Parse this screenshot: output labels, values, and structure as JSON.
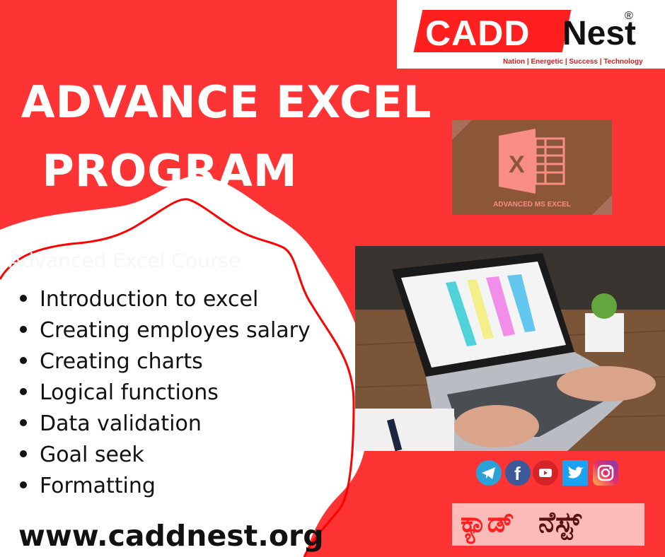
{
  "brand": {
    "name_part1": "CADD",
    "name_part2": "Nest",
    "registered": "®",
    "tagline": "Nation | Energetic | Success | Technology"
  },
  "title": {
    "line1": "ADVANCE EXCEL",
    "line2": "PROGRAM"
  },
  "course_card": {
    "label": "ADVANCED MS EXCEL",
    "icon_letter": "X"
  },
  "ghost_text": "Advanced Excel Course",
  "topics": [
    "Introduction to excel",
    "Creating employes salary",
    "Creating charts",
    "Logical functions",
    "Data validation",
    "Goal seek",
    "Formatting"
  ],
  "website": "www.caddnest.org",
  "social_icons": [
    "telegram-icon",
    "facebook-icon",
    "youtube-icon",
    "twitter-icon",
    "instagram-icon"
  ],
  "kannada_name": {
    "part1": "ಕ್ಯಾಡ್",
    "part2": "ನೆಸ್ಟ್"
  },
  "colors": {
    "background": "#fe3334",
    "accent_red": "#ff1f1f",
    "card_brown": "#8c5639",
    "card_pink": "#f78d85",
    "kannada_box": "#fbbbb8"
  }
}
